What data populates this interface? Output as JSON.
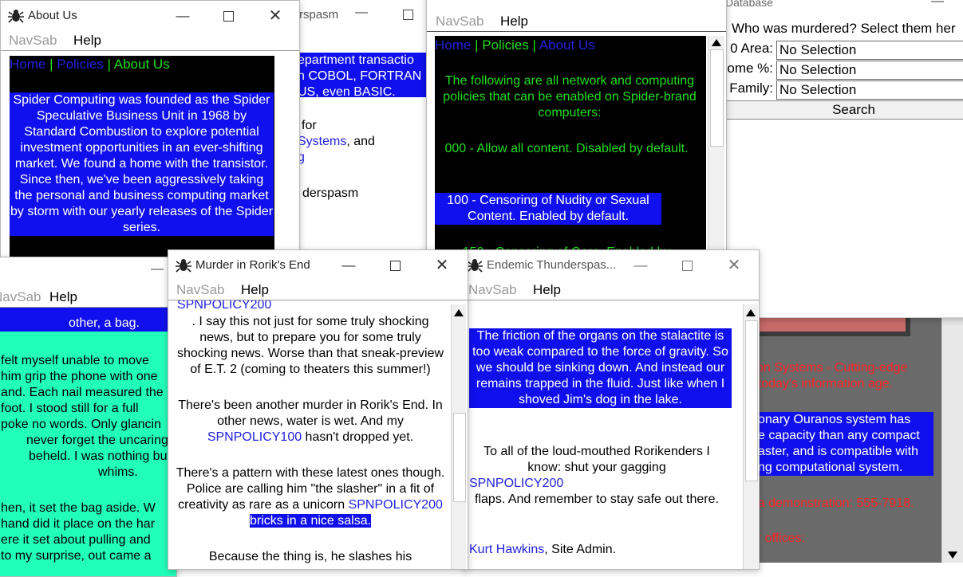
{
  "colors": {
    "blue_bar": "#1010ee",
    "green_text": "#22dd22",
    "black_bg": "#000000",
    "teal_bg": "#22ffbb",
    "red_text": "#ff2222",
    "gray_bg": "#6a6a6a"
  },
  "menu": {
    "nav": "NavSab",
    "help": "Help"
  },
  "about": {
    "title": "About Us",
    "nav_home": "Home",
    "nav_sep1": " | ",
    "nav_policies": "Policies",
    "nav_sep2": " | ",
    "nav_about": "About Us",
    "body": "Spider Computing was founded as the Spider Speculative Business Unit in 1968 by Standard Combustion to explore potential investment opportunities in an ever-shifting market. We found a home with the transistor. Since then, we've been aggressively taking the personal and business computing market by storm with our yearly releases of the Spider series."
  },
  "spasm_back": {
    "title_fragment": "rspasm",
    "line1": "epartment transactio",
    "line2": "n COBOL, FORTRAN",
    "line3": "US, even BASIC.",
    "line4": "for",
    "line5a": "Systems",
    "line5b": ", and",
    "line6": "g",
    "line7": "derspasm"
  },
  "policies": {
    "nav_home": "Home",
    "nav_sep1": " | ",
    "nav_policies": "Policies",
    "nav_sep2": " | ",
    "nav_about": "About Us",
    "intro": "The following are all network and computing policies that can be enabled on Spider-brand computers:",
    "p000": "000 - Allow all content. Disabled by default.",
    "p100": "100 - Censoring of Nudity or Sexual Content. Enabled by default.",
    "p150": "150 - Censoring of Gore. Enabled by"
  },
  "database": {
    "title_fragment": "Database",
    "question": "Who was murdered? Select them her",
    "fields": [
      {
        "label": "0 Area:",
        "value": "No Selection"
      },
      {
        "label": "ome %:",
        "value": "No Selection"
      },
      {
        "label": "Family:",
        "value": "No Selection"
      }
    ],
    "search": "Search"
  },
  "teal": {
    "l1": "other, a bag.",
    "l2": "felt myself unable to move",
    "l3": "him grip the phone with one",
    "l4": "and. Each nail measured the",
    "l5": "foot. I stood still for a full",
    "l6": "poke no words. Only glancin",
    "l7": "never forget the uncaring",
    "l8": "beheld. I was nothing but",
    "l9": "whims.",
    "l10": "hen, it set the bag aside. W",
    "l11": "hand did it place on the har",
    "l12": "ere it set about pulling and",
    "l13": "to my surprise, out came a"
  },
  "murder": {
    "title": "Murder in Rorik's End",
    "top_link": "SPNPOLICY200",
    "p1": ". I say this not just for some truly shocking news, but to prepare you for some truly shocking news. Worse than that sneak-preview of E.T. 2 (coming to theaters this summer!)",
    "p2a": "There's been another murder in Rorik's End. In other news, water is wet. And my",
    "p2link": "SPNPOLICY100",
    "p2b": " hasn't dropped yet.",
    "p3a": "There's a pattern with these latest ones though. Police are calling him \"the slasher\" in a fit of creativity as rare as a unicorn",
    "p3link": "SPNPOLICY200",
    "p3hl": " bricks in a nice salsa.",
    "p4": "Because the thing is, he slashes his"
  },
  "endemic": {
    "title": "Endemic Thunderspas...",
    "hl": "The friction of the organs on the stalactite is too weak compared to the force of gravity. So we should be sinking down. And instead our remains trapped in the fluid. Just like when I shoved Jim's dog in the lake.",
    "p2": "To all of the loud-mouthed Rorikenders I know: shut your gagging",
    "p2link": "SPNPOLICY200",
    "p2b": "flaps. And remember to stay safe out there.",
    "sig_link": "Kurt Hawkins",
    "sig_rest": ", Site Admin."
  },
  "ouranos": {
    "l1": "tion Systems - Cutting-edge",
    "l2": "r today's information age.",
    "hl1": "onary Ouranos system has",
    "hl2": "e capacity than any compact",
    "hl3": "aster, and is compatible with",
    "hl4": "ng computational system.",
    "demo": "r a demonstration: 555-7918.",
    "offices": "ur offices:"
  }
}
